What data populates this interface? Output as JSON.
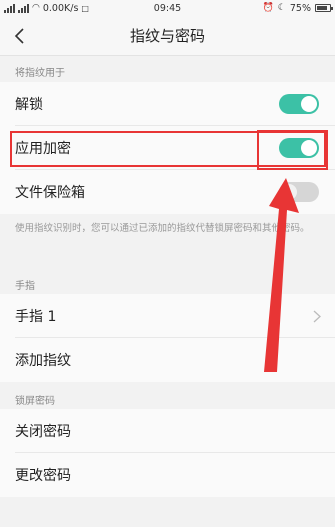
{
  "status_bar": {
    "left_text": "0.00K/s",
    "time": "09:45",
    "battery": "75%"
  },
  "nav": {
    "title": "指纹与密码"
  },
  "fingerprint_usage": {
    "header": "将指纹用于",
    "items": [
      {
        "label": "解锁",
        "enabled": true
      },
      {
        "label": "应用加密",
        "enabled": true
      },
      {
        "label": "文件保险箱",
        "enabled": false
      }
    ],
    "description": "使用指纹识别时，您可以通过已添加的指纹代替锁屏密码和其他密码。"
  },
  "fingers": {
    "header": "手指",
    "items": [
      {
        "label": "手指 1"
      },
      {
        "label": "添加指纹"
      }
    ]
  },
  "lock_password": {
    "header": "锁屏密码",
    "items": [
      {
        "label": "关闭密码"
      },
      {
        "label": "更改密码"
      }
    ]
  },
  "colors": {
    "toggle_on": "#3cc1a6",
    "toggle_off": "#d6d6d6",
    "annotation_red": "#e83535"
  }
}
